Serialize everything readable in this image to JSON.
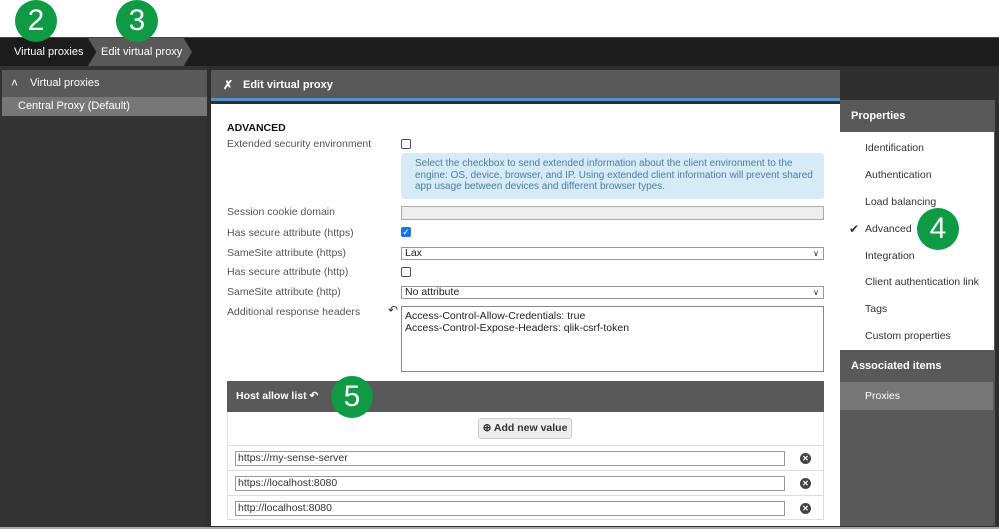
{
  "breadcrumb": [
    "Virtual proxies",
    "Edit virtual proxy"
  ],
  "sidebar": {
    "header": "Virtual proxies",
    "items": [
      "Central Proxy (Default)"
    ]
  },
  "main": {
    "title": "Edit virtual proxy",
    "section": "ADVANCED",
    "fields": {
      "extended_security": {
        "label": "Extended security environment",
        "checked": false
      },
      "info": "Select the checkbox to send extended information about the client environment to the engine: OS, device, browser, and IP. Using extended client information will prevent shared app usage between devices and different browser types.",
      "session_cookie_domain": {
        "label": "Session cookie domain",
        "value": ""
      },
      "secure_https": {
        "label": "Has secure attribute (https)",
        "checked": true
      },
      "samesite_https": {
        "label": "SameSite attribute (https)",
        "value": "Lax"
      },
      "secure_http": {
        "label": "Has secure attribute (http)",
        "checked": false
      },
      "samesite_http": {
        "label": "SameSite attribute (http)",
        "value": "No attribute"
      },
      "response_headers": {
        "label": "Additional response headers",
        "value": "Access-Control-Allow-Credentials: true\nAccess-Control-Expose-Headers: qlik-csrf-token"
      }
    },
    "host_allow_list": {
      "title": "Host allow list",
      "add_label": "Add new value",
      "values": [
        "https://my-sense-server",
        "https://localhost:8080",
        "http://localhost:8080"
      ]
    }
  },
  "right_panel": {
    "properties_header": "Properties",
    "properties": [
      "Identification",
      "Authentication",
      "Load balancing",
      "Advanced",
      "Integration",
      "Client authentication link",
      "Tags",
      "Custom properties"
    ],
    "selected": "Advanced",
    "associated_header": "Associated items",
    "associated": [
      "Proxies"
    ]
  },
  "callouts": [
    "2",
    "3",
    "4",
    "5"
  ],
  "colors": {
    "callout": "#0f9a45",
    "accent": "#5b8fc7",
    "info_bg": "#d6ebf5"
  }
}
